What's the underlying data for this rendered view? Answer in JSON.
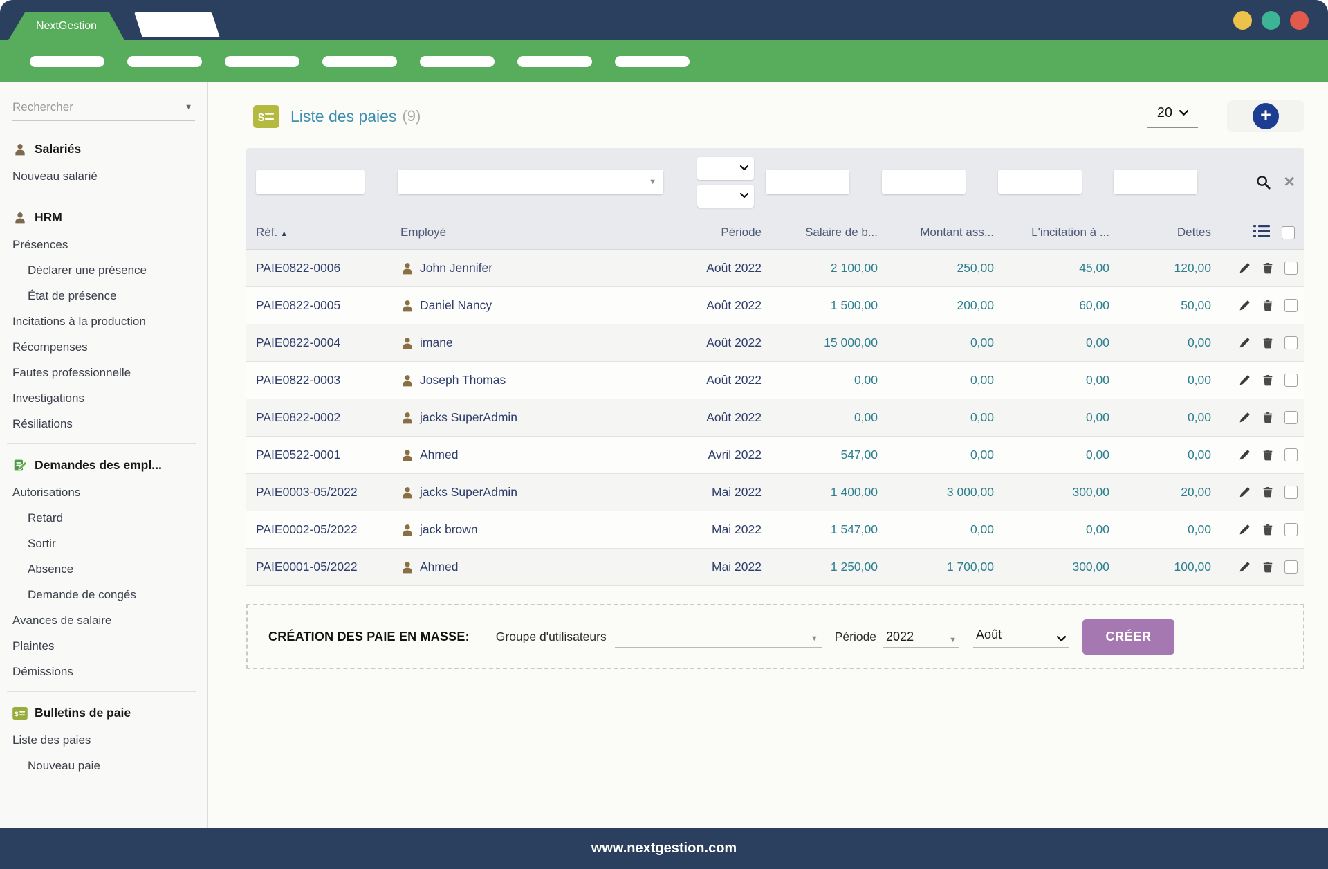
{
  "window": {
    "brand": "NextGestion",
    "dots": [
      {
        "name": "window-dot-yellow",
        "color": "#edc24b"
      },
      {
        "name": "window-dot-teal",
        "color": "#3eb496"
      },
      {
        "name": "window-dot-red",
        "color": "#e15a4c"
      }
    ]
  },
  "navbar": {
    "pills": 7
  },
  "sidebar": {
    "search": {
      "placeholder": "Rechercher",
      "value": ""
    },
    "items": [
      {
        "type": "header",
        "icon": "person-icon",
        "label": "Salariés"
      },
      {
        "type": "link",
        "label": "Nouveau salarié",
        "indent": 0
      },
      {
        "type": "divider"
      },
      {
        "type": "header",
        "icon": "person-icon",
        "label": "HRM"
      },
      {
        "type": "link",
        "label": "Présences",
        "indent": 0
      },
      {
        "type": "link",
        "label": "Déclarer une présence",
        "indent": 1
      },
      {
        "type": "link",
        "label": "État de présence",
        "indent": 1
      },
      {
        "type": "link",
        "label": "Incitations à la production",
        "indent": 0
      },
      {
        "type": "link",
        "label": "Récompenses",
        "indent": 0
      },
      {
        "type": "link",
        "label": "Fautes professionnelle",
        "indent": 0
      },
      {
        "type": "link",
        "label": "Investigations",
        "indent": 0
      },
      {
        "type": "link",
        "label": "Résiliations",
        "indent": 0
      },
      {
        "type": "divider"
      },
      {
        "type": "header",
        "icon": "request-edit-icon",
        "label": "Demandes des empl..."
      },
      {
        "type": "link",
        "label": "Autorisations",
        "indent": 0
      },
      {
        "type": "link",
        "label": "Retard",
        "indent": 1
      },
      {
        "type": "link",
        "label": "Sortir",
        "indent": 1
      },
      {
        "type": "link",
        "label": "Absence",
        "indent": 1
      },
      {
        "type": "link",
        "label": "Demande de congés",
        "indent": 1
      },
      {
        "type": "link",
        "label": "Avances de salaire",
        "indent": 0
      },
      {
        "type": "link",
        "label": "Plaintes",
        "indent": 0
      },
      {
        "type": "link",
        "label": "Démissions",
        "indent": 0
      },
      {
        "type": "divider"
      },
      {
        "type": "header",
        "icon": "payslip-icon",
        "label": "Bulletins de paie"
      },
      {
        "type": "link",
        "label": "Liste des paies",
        "indent": 0
      },
      {
        "type": "link",
        "label": "Nouveau paie",
        "indent": 1
      }
    ]
  },
  "main": {
    "header": {
      "title": "Liste des paies",
      "count": "(9)",
      "page_size": "20"
    },
    "filters": {
      "ref": "",
      "employee": "",
      "period_month": "",
      "period_year": "",
      "salary": "",
      "insurance": "",
      "incentive": "",
      "debts": ""
    },
    "table": {
      "columns": {
        "ref": "Réf.",
        "employee": "Employé",
        "period": "Période",
        "salary": "Salaire de b...",
        "insurance": "Montant ass...",
        "incentive": "L'incitation à ...",
        "debts": "Dettes"
      },
      "sort": {
        "column": "Réf.",
        "direction": "asc"
      },
      "rows": [
        {
          "ref": "PAIE0822-0006",
          "employee": "John Jennifer",
          "period": "Août 2022",
          "salary": "2 100,00",
          "insurance": "250,00",
          "incentive": "45,00",
          "debts": "120,00",
          "selected": false
        },
        {
          "ref": "PAIE0822-0005",
          "employee": "Daniel Nancy",
          "period": "Août 2022",
          "salary": "1 500,00",
          "insurance": "200,00",
          "incentive": "60,00",
          "debts": "50,00",
          "selected": false
        },
        {
          "ref": "PAIE0822-0004",
          "employee": "imane",
          "period": "Août 2022",
          "salary": "15 000,00",
          "insurance": "0,00",
          "incentive": "0,00",
          "debts": "0,00",
          "selected": false
        },
        {
          "ref": "PAIE0822-0003",
          "employee": "Joseph Thomas",
          "period": "Août 2022",
          "salary": "0,00",
          "insurance": "0,00",
          "incentive": "0,00",
          "debts": "0,00",
          "selected": false
        },
        {
          "ref": "PAIE0822-0002",
          "employee": "jacks SuperAdmin",
          "period": "Août 2022",
          "salary": "0,00",
          "insurance": "0,00",
          "incentive": "0,00",
          "debts": "0,00",
          "selected": false
        },
        {
          "ref": "PAIE0522-0001",
          "employee": "Ahmed",
          "period": "Avril 2022",
          "salary": "547,00",
          "insurance": "0,00",
          "incentive": "0,00",
          "debts": "0,00",
          "selected": false
        },
        {
          "ref": "PAIE0003-05/2022",
          "employee": "jacks SuperAdmin",
          "period": "Mai 2022",
          "salary": "1 400,00",
          "insurance": "3 000,00",
          "incentive": "300,00",
          "debts": "20,00",
          "selected": false
        },
        {
          "ref": "PAIE0002-05/2022",
          "employee": "jack brown",
          "period": "Mai 2022",
          "salary": "1 547,00",
          "insurance": "0,00",
          "incentive": "0,00",
          "debts": "0,00",
          "selected": false
        },
        {
          "ref": "PAIE0001-05/2022",
          "employee": "Ahmed",
          "period": "Mai 2022",
          "salary": "1 250,00",
          "insurance": "1 700,00",
          "incentive": "300,00",
          "debts": "100,00",
          "selected": false
        }
      ]
    },
    "mass_creation": {
      "title": "CRÉATION DES PAIE EN MASSE:",
      "group_label": "Groupe d'utilisateurs",
      "group_value": "",
      "period_label": "Période",
      "year": "2022",
      "month": "Août",
      "create_label": "CRÉER"
    }
  },
  "footer": {
    "url": "www.nextgestion.com"
  },
  "colors": {
    "navy": "#2b3f5e",
    "green": "#57ad5b",
    "olive_icon": "#b5b93f",
    "teal_number": "#2d7f8f",
    "title_teal": "#3f8fae",
    "purple_button": "#a678b2",
    "add_button_blue": "#1d3d92"
  }
}
